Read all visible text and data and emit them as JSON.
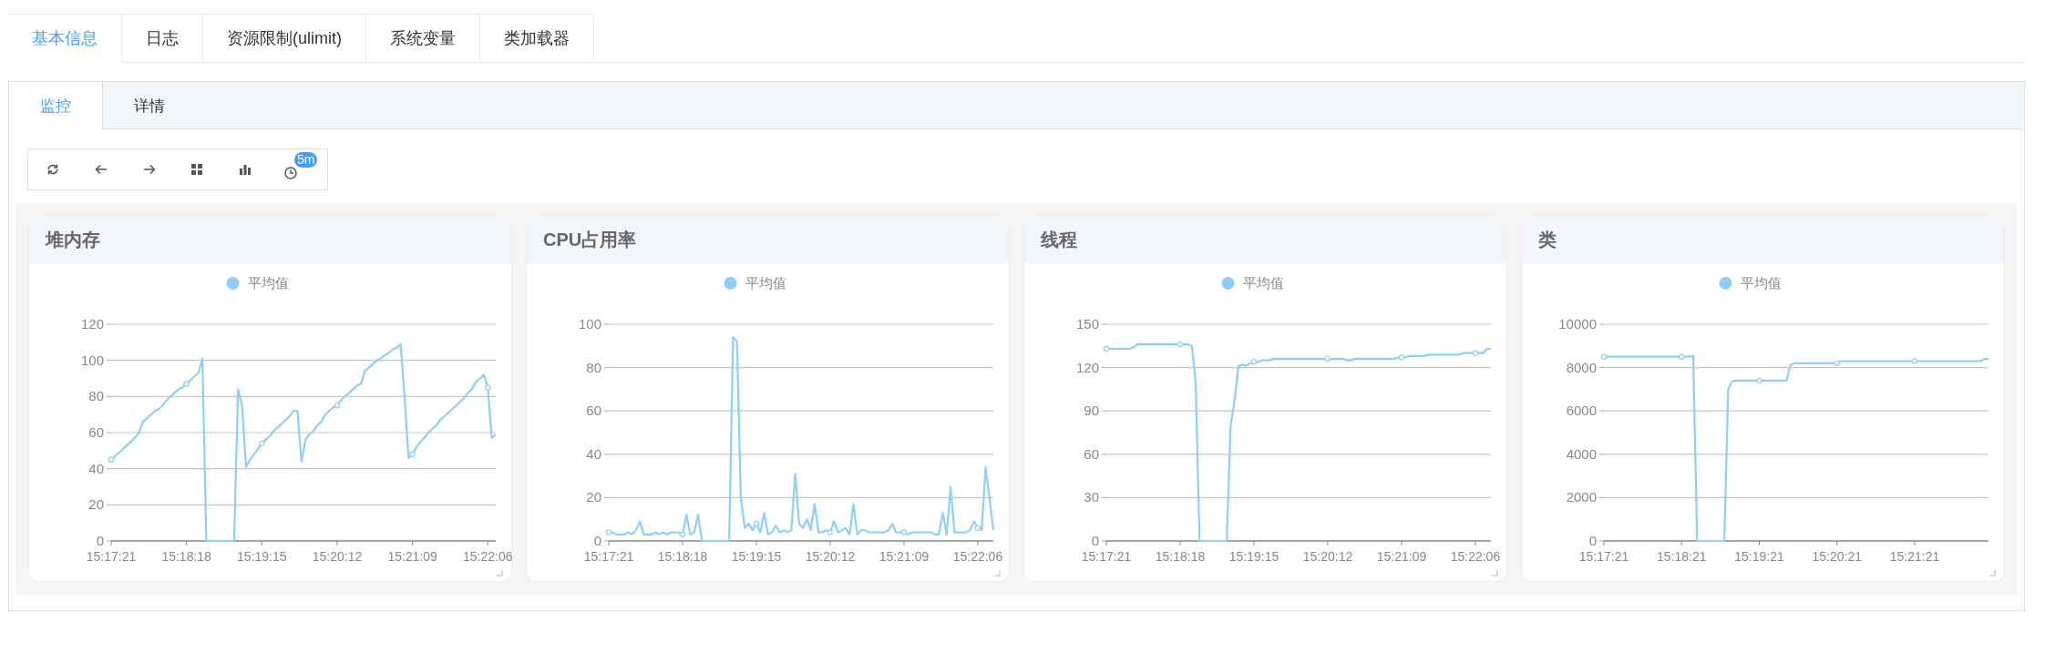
{
  "top_tabs": [
    {
      "label": "基本信息",
      "selected": true
    },
    {
      "label": "日志",
      "selected": false
    },
    {
      "label": "资源限制(ulimit)",
      "selected": false
    },
    {
      "label": "系统变量",
      "selected": false
    },
    {
      "label": "类加载器",
      "selected": false
    }
  ],
  "sub_tabs": [
    {
      "label": "监控",
      "selected": true
    },
    {
      "label": "详情",
      "selected": false
    }
  ],
  "toolbar": [
    {
      "kind": "refresh"
    },
    {
      "kind": "back"
    },
    {
      "kind": "forward"
    },
    {
      "kind": "grid"
    },
    {
      "kind": "bars"
    },
    {
      "kind": "clock",
      "badge": "5m"
    }
  ],
  "charts": [
    {
      "title": "堆内存",
      "chart_data": {
        "type": "line",
        "grid": true,
        "ylim": [
          0,
          120
        ],
        "yticks": [
          0,
          20,
          40,
          60,
          80,
          100,
          120
        ],
        "categories": [
          "15:17:21",
          null,
          null,
          null,
          null,
          null,
          null,
          null,
          null,
          null,
          null,
          null,
          null,
          null,
          null,
          null,
          null,
          null,
          null,
          "15:18:18",
          null,
          null,
          null,
          null,
          null,
          null,
          null,
          null,
          null,
          null,
          null,
          null,
          null,
          null,
          null,
          null,
          null,
          null,
          "15:19:15",
          null,
          null,
          null,
          null,
          null,
          null,
          null,
          null,
          null,
          null,
          null,
          null,
          null,
          null,
          null,
          null,
          null,
          null,
          "15:20:12",
          null,
          null,
          null,
          null,
          null,
          null,
          null,
          null,
          null,
          null,
          null,
          null,
          null,
          null,
          null,
          null,
          null,
          null,
          "15:21:09",
          null,
          null,
          null,
          null,
          null,
          null,
          null,
          null,
          null,
          null,
          null,
          null,
          null,
          null,
          null,
          null,
          null,
          null,
          "15:22:06",
          null,
          null
        ],
        "series": [
          {
            "name": "平均值",
            "color": "#8ccffb",
            "values": [
              45,
              47,
              49,
              51,
              53,
              55,
              57,
              60,
              66,
              68,
              70,
              72,
              73,
              75,
              78,
              80,
              82,
              84,
              85,
              87,
              89,
              91,
              93,
              101,
              0,
              0,
              0,
              0,
              0,
              0,
              0,
              0,
              84,
              75,
              41,
              45,
              48,
              51,
              54,
              56,
              58,
              61,
              63,
              65,
              67,
              69,
              72,
              72,
              44,
              56,
              59,
              61,
              64,
              66,
              70,
              72,
              74,
              75,
              78,
              80,
              82,
              84,
              86,
              87,
              94,
              96,
              98,
              100,
              101,
              103,
              104,
              106,
              107,
              109,
              80,
              46,
              48,
              52,
              55,
              57,
              60,
              62,
              64,
              67,
              69,
              71,
              73,
              75,
              77,
              79,
              82,
              84,
              88,
              90,
              92,
              85,
              57,
              59
            ]
          }
        ]
      }
    },
    {
      "title": "CPU占用率",
      "chart_data": {
        "type": "line",
        "grid": true,
        "ylim": [
          0,
          100
        ],
        "yticks": [
          0,
          20,
          40,
          60,
          80,
          100
        ],
        "categories": [
          "15:17:21",
          null,
          null,
          null,
          null,
          null,
          null,
          null,
          null,
          null,
          null,
          null,
          null,
          null,
          null,
          null,
          null,
          null,
          null,
          "15:18:18",
          null,
          null,
          null,
          null,
          null,
          null,
          null,
          null,
          null,
          null,
          null,
          null,
          null,
          null,
          null,
          null,
          null,
          null,
          "15:19:15",
          null,
          null,
          null,
          null,
          null,
          null,
          null,
          null,
          null,
          null,
          null,
          null,
          null,
          null,
          null,
          null,
          null,
          null,
          "15:20:12",
          null,
          null,
          null,
          null,
          null,
          null,
          null,
          null,
          null,
          null,
          null,
          null,
          null,
          null,
          null,
          null,
          null,
          null,
          "15:21:09",
          null,
          null,
          null,
          null,
          null,
          null,
          null,
          null,
          null,
          null,
          null,
          null,
          null,
          null,
          null,
          null,
          null,
          null,
          "15:22:06",
          null,
          null,
          null,
          null
        ],
        "series": [
          {
            "name": "平均值",
            "color": "#8ccffb",
            "values": [
              4,
              4,
              3,
              3,
              3,
              4,
              3,
              5,
              9,
              3,
              3,
              3,
              4,
              3,
              4,
              3,
              4,
              4,
              4,
              3,
              12,
              3,
              4,
              12,
              0,
              0,
              0,
              0,
              0,
              0,
              0,
              0,
              94,
              92,
              20,
              6,
              8,
              5,
              8,
              4,
              13,
              3,
              4,
              7,
              4,
              5,
              4,
              5,
              31,
              8,
              6,
              10,
              5,
              17,
              4,
              4,
              5,
              4,
              9,
              4,
              5,
              6,
              3,
              17,
              3,
              5,
              5,
              4,
              4,
              4,
              4,
              4,
              5,
              8,
              4,
              4,
              4,
              3,
              4,
              4,
              4,
              4,
              4,
              4,
              3,
              3,
              13,
              3,
              25,
              4,
              4,
              4,
              4,
              5,
              9,
              6,
              5,
              34,
              20,
              5
            ]
          }
        ]
      }
    },
    {
      "title": "线程",
      "chart_data": {
        "type": "line",
        "grid": true,
        "ylim": [
          0,
          150
        ],
        "yticks": [
          0,
          30,
          60,
          90,
          120,
          150
        ],
        "categories": [
          "15:17:21",
          null,
          null,
          null,
          null,
          null,
          null,
          null,
          null,
          null,
          null,
          null,
          null,
          null,
          null,
          null,
          null,
          null,
          null,
          "15:18:18",
          null,
          null,
          null,
          null,
          null,
          null,
          null,
          null,
          null,
          null,
          null,
          null,
          null,
          null,
          null,
          null,
          null,
          null,
          "15:19:15",
          null,
          null,
          null,
          null,
          null,
          null,
          null,
          null,
          null,
          null,
          null,
          null,
          null,
          null,
          null,
          null,
          null,
          null,
          "15:20:12",
          null,
          null,
          null,
          null,
          null,
          null,
          null,
          null,
          null,
          null,
          null,
          null,
          null,
          null,
          null,
          null,
          null,
          null,
          "15:21:09",
          null,
          null,
          null,
          null,
          null,
          null,
          null,
          null,
          null,
          null,
          null,
          null,
          null,
          null,
          null,
          null,
          null,
          null,
          "15:22:06",
          null,
          null,
          null,
          null
        ],
        "series": [
          {
            "name": "平均值",
            "color": "#8ccffb",
            "values": [
              133,
              133,
              133,
              133,
              133,
              133,
              133,
              134,
              136,
              136,
              136,
              136,
              136,
              136,
              136,
              136,
              136,
              136,
              136,
              136,
              136,
              136,
              135,
              110,
              0,
              0,
              0,
              0,
              0,
              0,
              0,
              0,
              80,
              97,
              121,
              122,
              121,
              123,
              124,
              124,
              125,
              125,
              125,
              126,
              126,
              126,
              126,
              126,
              126,
              126,
              126,
              126,
              126,
              126,
              126,
              126,
              126,
              126,
              126,
              126,
              126,
              126,
              125,
              125,
              126,
              126,
              126,
              126,
              126,
              126,
              126,
              126,
              126,
              126,
              126,
              127,
              127,
              127,
              128,
              128,
              128,
              128,
              128,
              129,
              129,
              129,
              129,
              129,
              129,
              129,
              129,
              129,
              130,
              130,
              130,
              130,
              130,
              130,
              133,
              133
            ]
          }
        ]
      }
    },
    {
      "title": "类",
      "chart_data": {
        "type": "line",
        "grid": true,
        "ylim": [
          0,
          10000
        ],
        "yticks": [
          0,
          2000,
          4000,
          6000,
          8000,
          10000
        ],
        "categories": [
          "15:17:21",
          null,
          null,
          null,
          null,
          null,
          null,
          null,
          null,
          null,
          null,
          null,
          null,
          null,
          null,
          null,
          null,
          null,
          null,
          null,
          "15:18:21",
          null,
          null,
          null,
          null,
          null,
          null,
          null,
          null,
          null,
          null,
          null,
          null,
          null,
          null,
          null,
          null,
          null,
          null,
          null,
          "15:19:21",
          null,
          null,
          null,
          null,
          null,
          null,
          null,
          null,
          null,
          null,
          null,
          null,
          null,
          null,
          null,
          null,
          null,
          null,
          null,
          "15:20:21",
          null,
          null,
          null,
          null,
          null,
          null,
          null,
          null,
          null,
          null,
          null,
          null,
          null,
          null,
          null,
          null,
          null,
          null,
          null,
          "15:21:21",
          null,
          null,
          null,
          null,
          null,
          null,
          null,
          null,
          null,
          null,
          null,
          null,
          null,
          null,
          null,
          null,
          null,
          null,
          null
        ],
        "series": [
          {
            "name": "平均值",
            "color": "#8ccffb",
            "values": [
              8500,
              8500,
              8500,
              8500,
              8500,
              8500,
              8500,
              8500,
              8500,
              8500,
              8500,
              8500,
              8500,
              8500,
              8500,
              8500,
              8500,
              8500,
              8500,
              8500,
              8500,
              8500,
              8500,
              8550,
              0,
              0,
              0,
              0,
              0,
              0,
              0,
              0,
              7000,
              7350,
              7400,
              7400,
              7400,
              7400,
              7400,
              7400,
              7400,
              7400,
              7400,
              7400,
              7400,
              7400,
              7400,
              7400,
              8100,
              8200,
              8200,
              8200,
              8200,
              8200,
              8200,
              8200,
              8200,
              8200,
              8200,
              8200,
              8200,
              8300,
              8300,
              8300,
              8300,
              8300,
              8300,
              8300,
              8300,
              8300,
              8300,
              8300,
              8300,
              8300,
              8300,
              8300,
              8300,
              8300,
              8300,
              8300,
              8300,
              8300,
              8300,
              8300,
              8300,
              8300,
              8300,
              8300,
              8300,
              8300,
              8300,
              8300,
              8300,
              8300,
              8300,
              8300,
              8300,
              8300,
              8400,
              8400
            ]
          }
        ]
      }
    }
  ]
}
